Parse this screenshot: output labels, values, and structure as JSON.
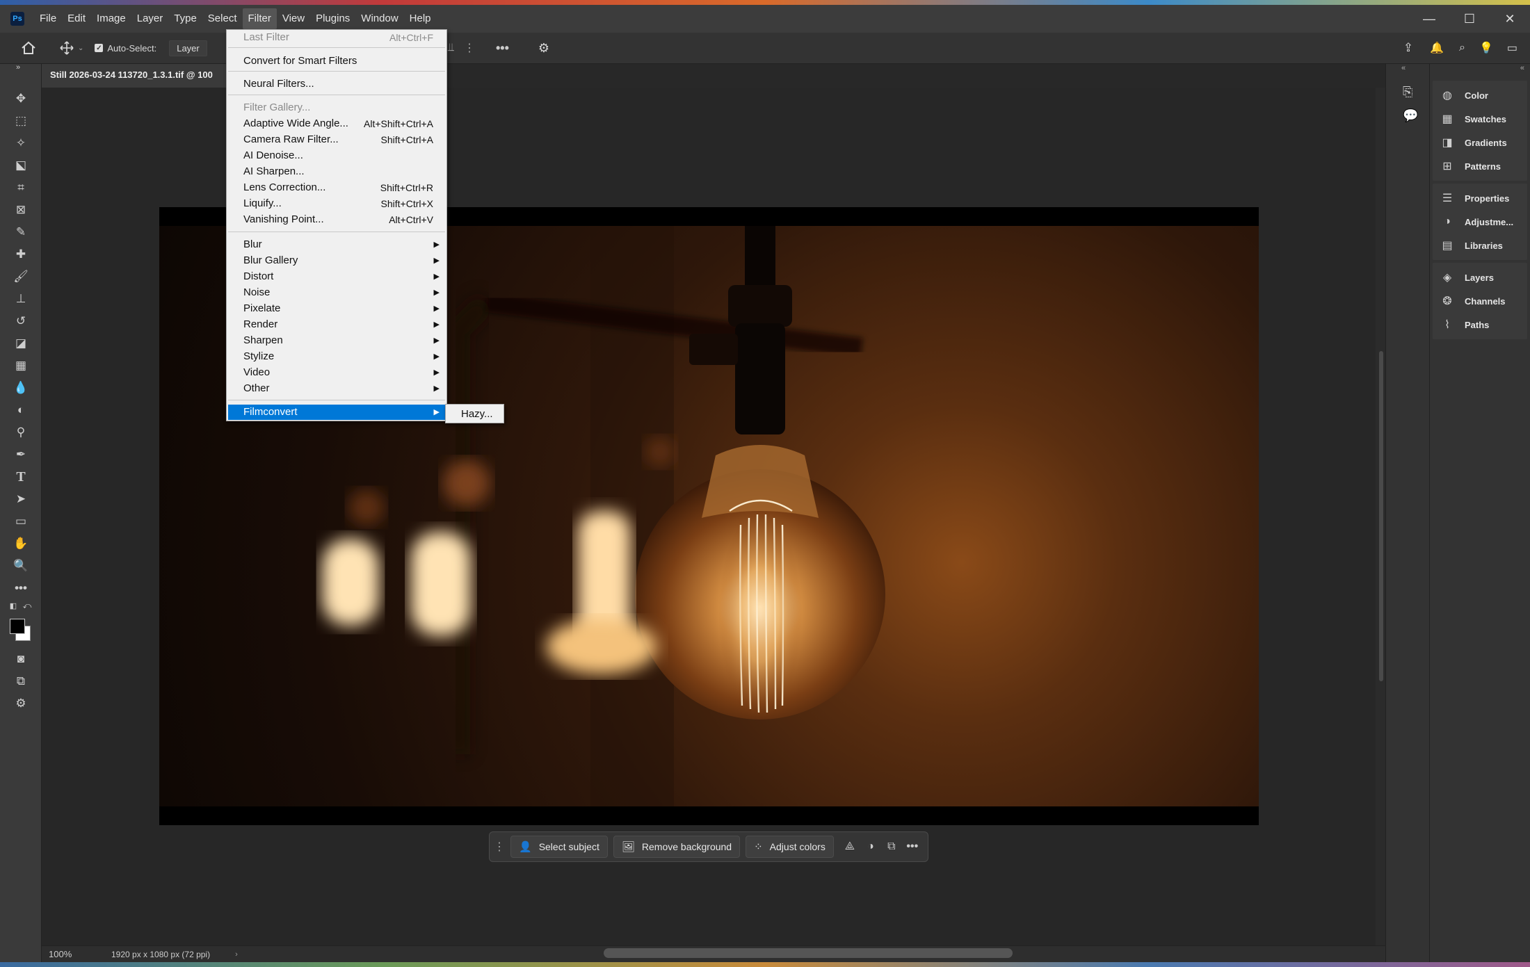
{
  "titlebar": {
    "logo": "Ps",
    "menu": [
      "File",
      "Edit",
      "Image",
      "Layer",
      "Type",
      "Select",
      "Filter",
      "View",
      "Plugins",
      "Window",
      "Help"
    ],
    "active_menu": "Filter",
    "window_controls": {
      "minimize": "—",
      "maximize": "☐",
      "close": "✕"
    }
  },
  "optionsbar": {
    "auto_select_label": "Auto-Select:",
    "auto_select_checked": true,
    "auto_select_value": "Layer"
  },
  "document": {
    "tab_title": "Still 2026-03-24 113720_1.3.1.tif @ 100"
  },
  "statusbar": {
    "zoom": "100%",
    "doc_info": "1920 px x 1080 px (72 ppi)"
  },
  "filter_menu": {
    "items": [
      {
        "label": "Last Filter",
        "shortcut": "Alt+Ctrl+F",
        "disabled": true
      },
      {
        "label": "Convert for Smart Filters",
        "shortcut": ""
      },
      {
        "label": "Neural Filters...",
        "shortcut": ""
      },
      {
        "label": "Filter Gallery...",
        "shortcut": "",
        "disabled": true
      },
      {
        "label": "Adaptive Wide Angle...",
        "shortcut": "Alt+Shift+Ctrl+A"
      },
      {
        "label": "Camera Raw Filter...",
        "shortcut": "Shift+Ctrl+A"
      },
      {
        "label": "AI Denoise...",
        "shortcut": ""
      },
      {
        "label": "AI Sharpen...",
        "shortcut": ""
      },
      {
        "label": "Lens Correction...",
        "shortcut": "Shift+Ctrl+R"
      },
      {
        "label": "Liquify...",
        "shortcut": "Shift+Ctrl+X"
      },
      {
        "label": "Vanishing Point...",
        "shortcut": "Alt+Ctrl+V"
      },
      {
        "label": "Blur",
        "submenu": true
      },
      {
        "label": "Blur Gallery",
        "submenu": true
      },
      {
        "label": "Distort",
        "submenu": true
      },
      {
        "label": "Noise",
        "submenu": true
      },
      {
        "label": "Pixelate",
        "submenu": true
      },
      {
        "label": "Render",
        "submenu": true
      },
      {
        "label": "Sharpen",
        "submenu": true
      },
      {
        "label": "Stylize",
        "submenu": true
      },
      {
        "label": "Video",
        "submenu": true
      },
      {
        "label": "Other",
        "submenu": true
      },
      {
        "label": "Filmconvert",
        "submenu": true,
        "highlighted": true
      }
    ],
    "submenu_items": [
      "Hazy..."
    ]
  },
  "contextual_taskbar": {
    "select_subject": "Select subject",
    "remove_background": "Remove background",
    "adjust_colors": "Adjust colors"
  },
  "right_panels": {
    "groups": [
      [
        {
          "label": "Color",
          "icon": "color-wheel-icon"
        },
        {
          "label": "Swatches",
          "icon": "swatches-grid-icon"
        },
        {
          "label": "Gradients",
          "icon": "gradient-icon"
        },
        {
          "label": "Patterns",
          "icon": "patterns-icon"
        }
      ],
      [
        {
          "label": "Properties",
          "icon": "sliders-icon"
        },
        {
          "label": "Adjustme...",
          "icon": "adjustments-icon"
        },
        {
          "label": "Libraries",
          "icon": "libraries-icon"
        }
      ],
      [
        {
          "label": "Layers",
          "icon": "layers-icon"
        },
        {
          "label": "Channels",
          "icon": "channels-icon"
        },
        {
          "label": "Paths",
          "icon": "paths-icon"
        }
      ]
    ]
  },
  "colors": {
    "menu_highlight": "#0078d7",
    "app_bg": "#282828",
    "panel_bg": "#333333"
  }
}
